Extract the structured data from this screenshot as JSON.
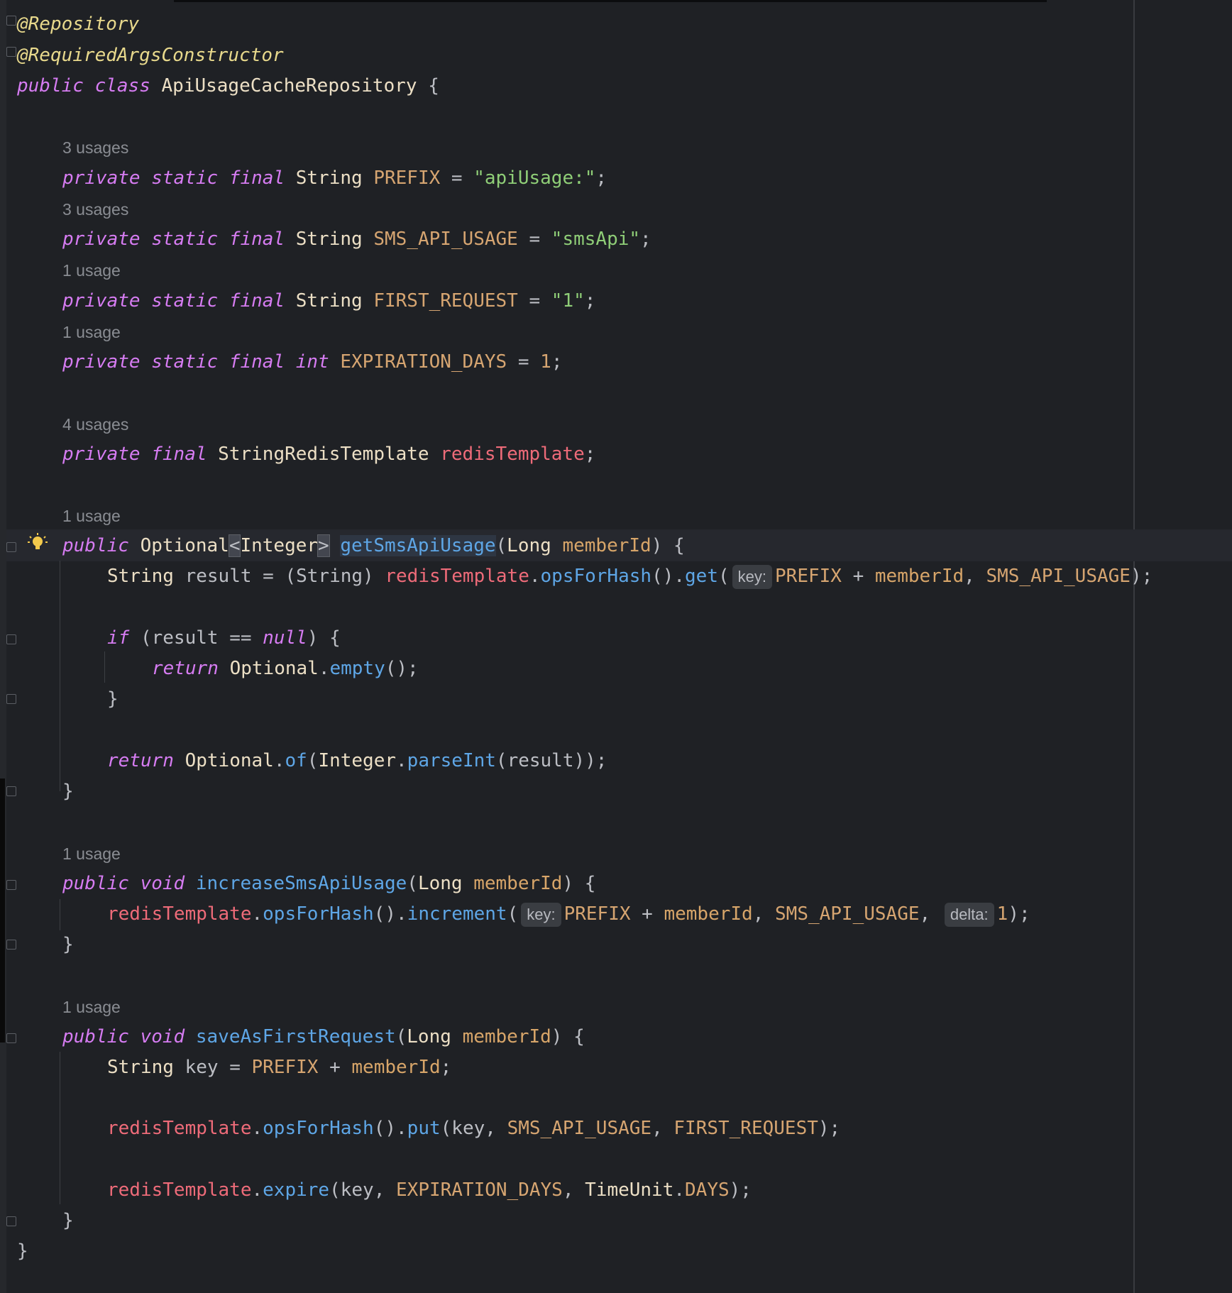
{
  "editor": {
    "lines": {
      "l1": "@Repository",
      "l2": "@RequiredArgsConstructor",
      "l3_kw1": "public",
      "l3_kw2": "class",
      "l3_name": "ApiUsageCacheRepository",
      "l3_brace": "{",
      "kw_private": "private",
      "kw_static": "static",
      "kw_final": "final",
      "kw_public": "public",
      "kw_void": "void",
      "kw_int": "int",
      "kw_if": "if",
      "kw_null": "null",
      "kw_return": "return",
      "type_string": "String",
      "prefix_name": "PREFIX",
      "prefix_value": "\"apiUsage:\"",
      "sms_name": "SMS_API_USAGE",
      "sms_value": "\"smsApi\"",
      "first_name": "FIRST_REQUEST",
      "first_value": "\"1\"",
      "exp_name": "EXPIRATION_DAYS",
      "exp_value": "1",
      "redis_type": "StringRedisTemplate",
      "redis_field": "redisTemplate",
      "optional": "Optional",
      "integer": "Integer",
      "get_method": "getSmsApiUsage",
      "long_type": "Long",
      "member_id": "memberId",
      "result_var": "result",
      "string_cast": "(String)",
      "ops_for_hash": "opsForHash",
      "get_call": "get",
      "empty_call": "empty",
      "of_call": "of",
      "parse_int": "parseInt",
      "increase_method": "increaseSmsApiUsage",
      "increment_call": "increment",
      "save_method": "saveAsFirstRequest",
      "key_var": "key",
      "put_call": "put",
      "expire_call": "expire",
      "time_unit": "TimeUnit",
      "days": "DAYS",
      "one": "1"
    },
    "hints": {
      "three_usages": "3 usages",
      "one_usage": "1 usage",
      "four_usages": "4 usages",
      "key_hint": "key:",
      "delta_hint": "delta:"
    },
    "colors": {
      "background": "#1f2125",
      "keyword": "#d67cf2",
      "annotation": "#e8d98c",
      "string": "#8fce77",
      "constant": "#d6a571",
      "field": "#ee6b79",
      "method": "#5ea6e6"
    }
  }
}
